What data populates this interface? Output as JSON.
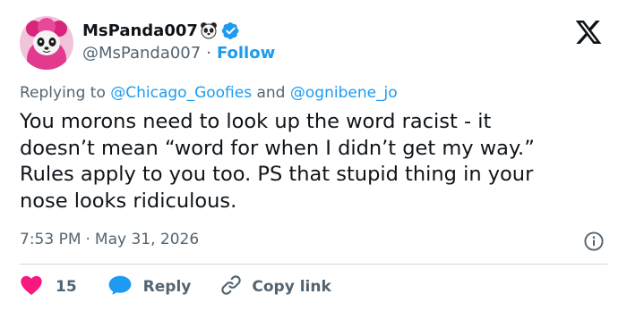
{
  "author": {
    "display_name": "MsPanda007",
    "handle": "@MsPanda007",
    "separator": "·",
    "follow_label": "Follow",
    "name_emoji_icon": "panda-face-icon",
    "verified_icon": "verified-badge-icon",
    "avatar_icon": "panda-avatar"
  },
  "brand": {
    "logo_icon": "x-logo-icon",
    "accent": "#1d9bf0"
  },
  "reply_context": {
    "prefix": "Replying to ",
    "mention_1": "@Chicago_Goofies",
    "joiner": " and ",
    "mention_2": "@ognibene_jo"
  },
  "tweet": {
    "text": "You morons need to look up the word racist - it\ndoesn’t mean “word for when I didn’t get my way.”\nRules apply to you too. PS that stupid thing in your\nnose looks ridiculous."
  },
  "meta": {
    "time": "7:53 PM",
    "separator": "·",
    "date": "May 31, 2026",
    "info_icon": "info-icon"
  },
  "actions": {
    "like_icon": "heart-icon",
    "like_count": "15",
    "reply_icon": "reply-bubble-icon",
    "reply_label": "Reply",
    "copy_icon": "link-icon",
    "copy_label": "Copy link"
  },
  "colors": {
    "text_primary": "#0f1419",
    "text_secondary": "#536471",
    "like": "#f91880",
    "divider": "#cfd9de"
  }
}
